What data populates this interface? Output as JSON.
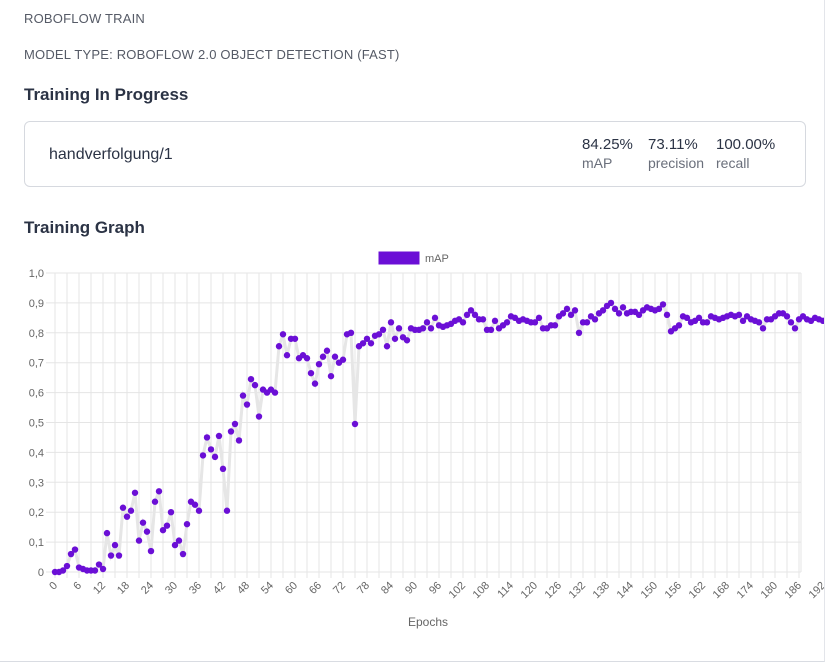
{
  "header": {
    "product": "ROBOFLOW TRAIN",
    "model_type": "MODEL TYPE: ROBOFLOW 2.0 OBJECT DETECTION (FAST)"
  },
  "progress": {
    "title": "Training In Progress",
    "model_name": "handverfolgung/1",
    "metrics": [
      {
        "value": "84.25%",
        "label": "mAP"
      },
      {
        "value": "73.11%",
        "label": "precision"
      },
      {
        "value": "100.00%",
        "label": "recall"
      }
    ]
  },
  "graph": {
    "title": "Training Graph"
  },
  "colors": {
    "point": "#6b0fd6",
    "line": "#e6e6e6",
    "grid": "#e5e5e5"
  },
  "chart_data": {
    "type": "line",
    "xlabel": "Epochs",
    "ylabel": "",
    "ylim": [
      0,
      1
    ],
    "y_ticks": [
      "0",
      "0,1",
      "0,2",
      "0,3",
      "0,4",
      "0,5",
      "0,6",
      "0,7",
      "0,8",
      "0,9",
      "1,0"
    ],
    "x_ticks": [
      "0",
      "6",
      "12",
      "18",
      "24",
      "30",
      "36",
      "42",
      "48",
      "54",
      "60",
      "66",
      "72",
      "78",
      "84",
      "90",
      "96",
      "102",
      "108",
      "114",
      "120",
      "126",
      "132",
      "138",
      "144",
      "150",
      "156",
      "162",
      "168",
      "174",
      "180",
      "186",
      "192"
    ],
    "legend": "top-center",
    "grid": true,
    "series": [
      {
        "name": "mAP",
        "values": [
          0.0,
          0.0,
          0.005,
          0.02,
          0.06,
          0.075,
          0.015,
          0.01,
          0.005,
          0.005,
          0.005,
          0.025,
          0.01,
          0.13,
          0.055,
          0.09,
          0.055,
          0.215,
          0.185,
          0.205,
          0.265,
          0.105,
          0.165,
          0.135,
          0.07,
          0.235,
          0.27,
          0.14,
          0.155,
          0.2,
          0.09,
          0.105,
          0.06,
          0.16,
          0.235,
          0.225,
          0.205,
          0.39,
          0.45,
          0.41,
          0.385,
          0.455,
          0.345,
          0.205,
          0.47,
          0.495,
          0.44,
          0.59,
          0.56,
          0.645,
          0.625,
          0.52,
          0.61,
          0.6,
          0.61,
          0.6,
          0.755,
          0.795,
          0.725,
          0.78,
          0.78,
          0.715,
          0.725,
          0.715,
          0.665,
          0.63,
          0.695,
          0.72,
          0.74,
          0.655,
          0.72,
          0.7,
          0.71,
          0.795,
          0.8,
          0.495,
          0.755,
          0.765,
          0.78,
          0.765,
          0.79,
          0.795,
          0.81,
          0.755,
          0.835,
          0.78,
          0.815,
          0.785,
          0.775,
          0.815,
          0.81,
          0.81,
          0.815,
          0.835,
          0.815,
          0.85,
          0.825,
          0.82,
          0.825,
          0.83,
          0.84,
          0.845,
          0.835,
          0.86,
          0.875,
          0.86,
          0.845,
          0.845,
          0.81,
          0.81,
          0.84,
          0.815,
          0.825,
          0.835,
          0.855,
          0.85,
          0.84,
          0.845,
          0.84,
          0.835,
          0.835,
          0.85,
          0.815,
          0.815,
          0.825,
          0.825,
          0.855,
          0.865,
          0.88,
          0.86,
          0.875,
          0.8,
          0.835,
          0.835,
          0.855,
          0.845,
          0.865,
          0.875,
          0.89,
          0.9,
          0.88,
          0.865,
          0.885,
          0.865,
          0.87,
          0.87,
          0.86,
          0.875,
          0.885,
          0.88,
          0.875,
          0.88,
          0.895,
          0.86,
          0.805,
          0.815,
          0.825,
          0.855,
          0.85,
          0.835,
          0.84,
          0.85,
          0.835,
          0.835,
          0.855,
          0.85,
          0.845,
          0.85,
          0.855,
          0.86,
          0.855,
          0.86,
          0.84,
          0.855,
          0.845,
          0.84,
          0.835,
          0.815,
          0.845,
          0.845,
          0.855,
          0.865,
          0.865,
          0.855,
          0.835,
          0.815,
          0.845,
          0.855,
          0.845,
          0.84,
          0.85,
          0.845,
          0.84,
          0.845,
          0.84
        ]
      }
    ]
  }
}
